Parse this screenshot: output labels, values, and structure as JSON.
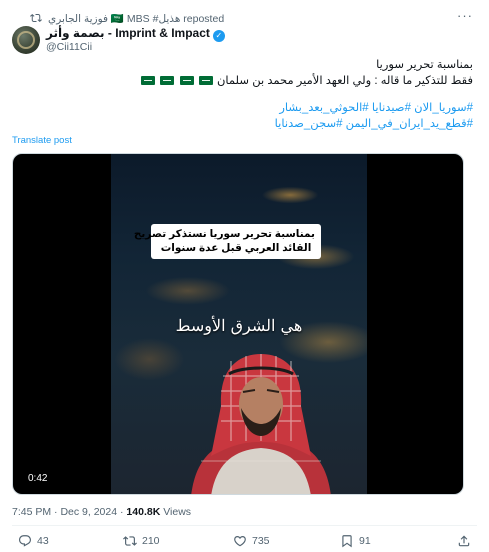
{
  "repost": {
    "text": "فوزية الجابري 🇸🇦 MBS #هذيل reposted",
    "icon": "repost-icon"
  },
  "more_label": "···",
  "author": {
    "name": "بصمة وأثر - Imprint & Impact",
    "verified_mark": "✓",
    "handle": "@Cii11Cii"
  },
  "tweet": {
    "lines": [
      "بمناسبة تحرير سوريا",
      "فقط للتذكير ما قاله : ولي العهد الأمير محمد بن سلمان"
    ],
    "hashtag_lines": [
      "#سوريا_الان #صيدنايا #الحوثي_بعد_بشار",
      "#قطع_يد_ايران_في_اليمن #سجن_صدنايا"
    ],
    "flag_count": 4
  },
  "translate_label": "Translate post",
  "video": {
    "caption_lines": [
      "بمناسبة تحرير سوريا نستذكر تصريح",
      "القائد العربي قبل عدة سنوات"
    ],
    "overlay_text": "هي الشرق الأوسط",
    "duration": "0:42"
  },
  "meta": {
    "time": "7:45 PM",
    "separator": " · ",
    "date": "Dec 9, 2024",
    "views_count": "140.8K",
    "views_label": "Views"
  },
  "actions": {
    "replies": "43",
    "reposts": "210",
    "likes": "735",
    "bookmarks": "91"
  },
  "colors": {
    "accent": "#1d9bf0",
    "text": "#0f1419",
    "muted": "#536471",
    "flag_green": "#006c35"
  }
}
